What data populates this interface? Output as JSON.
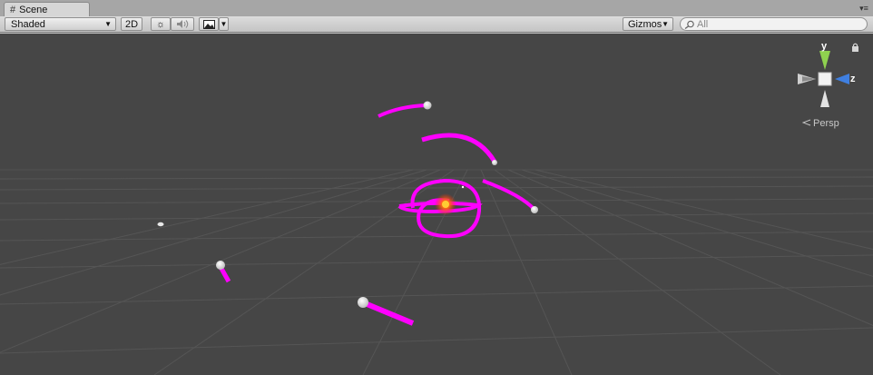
{
  "tab": {
    "icon": "grid-icon",
    "label": "Scene"
  },
  "toolbar": {
    "shading_mode": "Shaded",
    "mode_2d_label": "2D",
    "lighting_icon": "sun-icon",
    "audio_icon": "speaker-icon",
    "effects_icon": "image-icon",
    "gizmos_label": "Gizmos",
    "search": {
      "icon": "search-icon",
      "placeholder": "All"
    }
  },
  "viewport": {
    "background": "#464646",
    "grid_color": "#5a5a5a",
    "trail_color": "#ff00ff",
    "gizmo": {
      "y_label": "y",
      "z_label": "z",
      "y_color": "#8fd14f",
      "z_color": "#3f7fe0",
      "projection_label": "Persp"
    }
  }
}
